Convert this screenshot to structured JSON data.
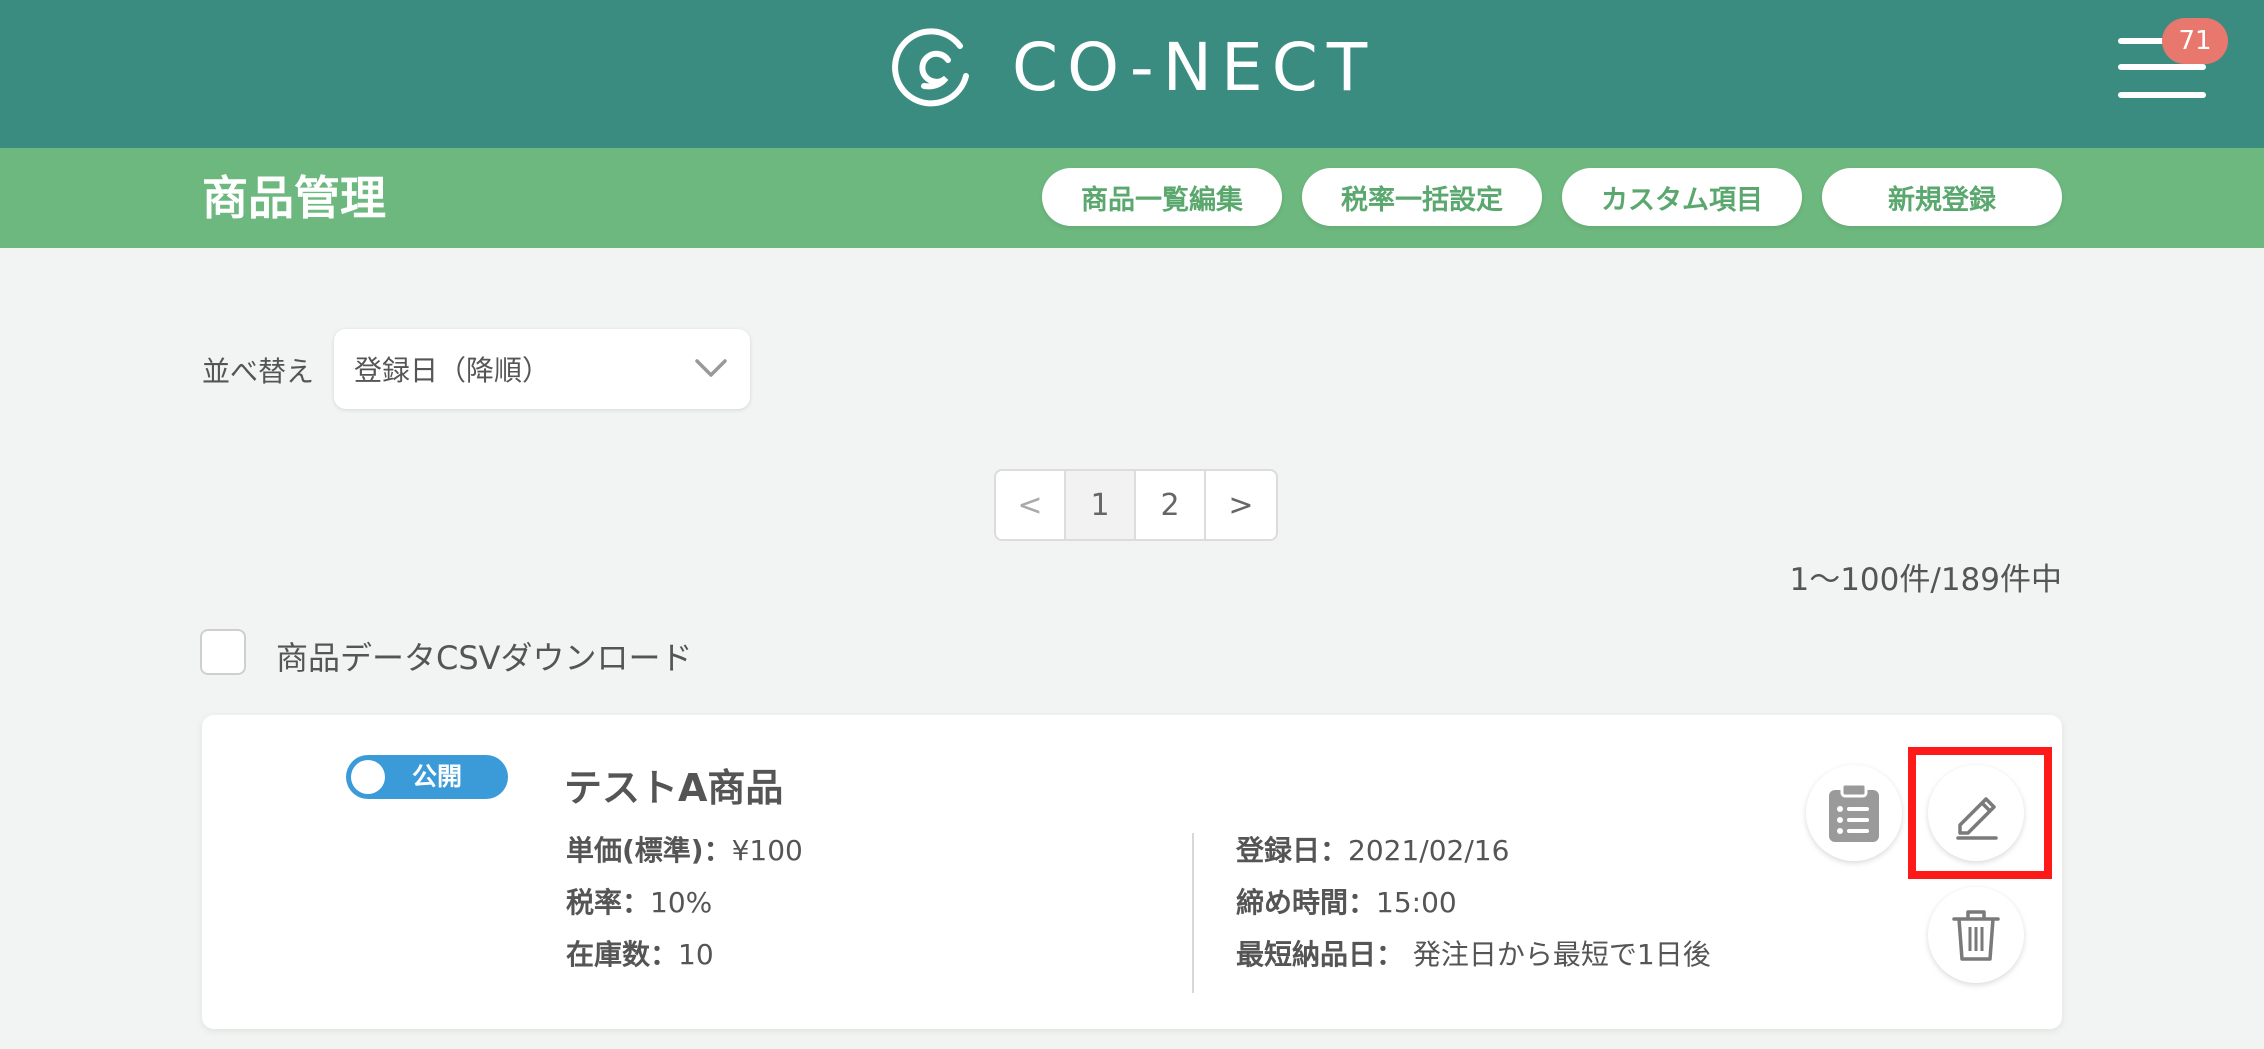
{
  "header": {
    "brand": "CO-NECT",
    "notification_count": "71",
    "colors": {
      "header_bg": "#3b8c80",
      "subheader_bg": "#6db87f",
      "badge": "#e8786d"
    }
  },
  "subheader": {
    "title": "商品管理",
    "buttons": [
      "商品一覧編集",
      "税率一括設定",
      "カスタム項目",
      "新規登録"
    ]
  },
  "sort": {
    "label": "並べ替え",
    "selected": "登録日（降順）"
  },
  "pagination": {
    "prev": "<",
    "pages": [
      "1",
      "2"
    ],
    "next": ">",
    "current": "1"
  },
  "count_text": "1〜100件/189件中",
  "csv": {
    "label": "商品データCSVダウンロード",
    "checked": false
  },
  "product": {
    "status": "公開",
    "name": "テストA商品",
    "left": [
      {
        "label": "単価(標準)：",
        "value": "¥100"
      },
      {
        "label": "税率：",
        "value": "10%"
      },
      {
        "label": "在庫数：",
        "value": "10"
      }
    ],
    "right": [
      {
        "label": "登録日：",
        "value": "2021/02/16"
      },
      {
        "label": "締め時間：",
        "value": "15:00"
      },
      {
        "label": "最短納品日：",
        "value": " 発注日から最短で1日後"
      }
    ],
    "icons": [
      "clipboard-icon",
      "edit-icon",
      "trash-icon"
    ]
  }
}
